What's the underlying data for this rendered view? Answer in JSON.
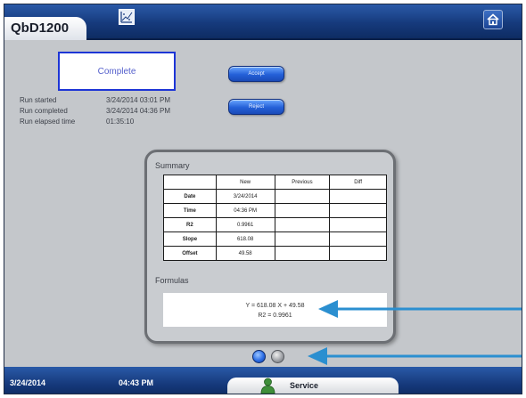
{
  "header": {
    "title": "QbD1200",
    "chart_icon": "chart-icon",
    "home_icon": "home-icon"
  },
  "status": {
    "label": "Complete",
    "border_color": "#1d35d6"
  },
  "run_info": [
    {
      "label": "Run started",
      "value": "3/24/2014 03:01 PM"
    },
    {
      "label": "Run completed",
      "value": "3/24/2014 04:36 PM"
    },
    {
      "label": "Run elapsed time",
      "value": "01:35:10"
    }
  ],
  "buttons": {
    "accept": "Accept",
    "reject": "Reject"
  },
  "summary": {
    "title": "Summary",
    "columns": [
      "",
      "New",
      "Previous",
      "Diff"
    ],
    "rows": [
      {
        "label": "Date",
        "new": "3/24/2014",
        "previous": "",
        "diff": ""
      },
      {
        "label": "Time",
        "new": "04:36 PM",
        "previous": "",
        "diff": ""
      },
      {
        "label": "R2",
        "new": "0.9961",
        "previous": "",
        "diff": ""
      },
      {
        "label": "Slope",
        "new": "618.08",
        "previous": "",
        "diff": ""
      },
      {
        "label": "Offset",
        "new": "49.58",
        "previous": "",
        "diff": ""
      }
    ]
  },
  "formulas": {
    "title": "Formulas",
    "line1": "Y = 618.08 X + 49.58",
    "line2": "R2 = 0.9961"
  },
  "pager": {
    "active_page": 1,
    "page_count": 2
  },
  "footer": {
    "date": "3/24/2014",
    "time": "04:43 PM",
    "service_label": "Service",
    "service_icon": "person-icon"
  },
  "colors": {
    "accent_blue": "#1c4595",
    "annotation_arrow": "#2b8fd0"
  }
}
